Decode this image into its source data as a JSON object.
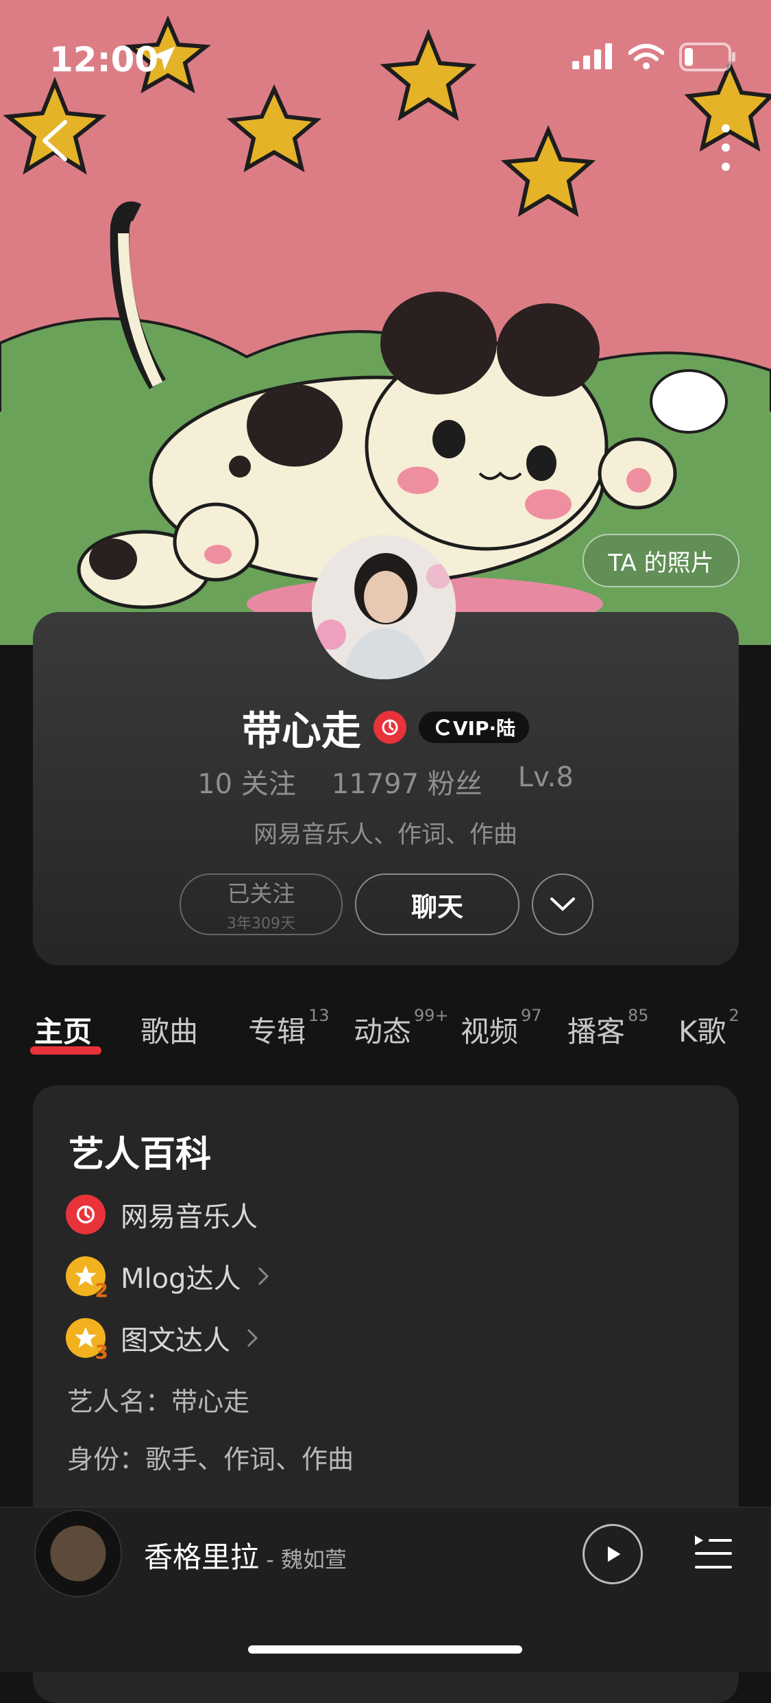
{
  "status": {
    "time": "12:00"
  },
  "photos_button": "TA 的照片",
  "profile": {
    "name": "带心走",
    "vip_label": "VIP·陆",
    "stats": [
      "10 关注",
      "11797 粉丝",
      "Lv.8"
    ],
    "bio": "网易音乐人、作词、作曲",
    "followed_label": "已关注",
    "followed_duration": "3年309天",
    "chat_label": "聊天"
  },
  "tabs": [
    {
      "label": "主页",
      "count": ""
    },
    {
      "label": "歌曲",
      "count": ""
    },
    {
      "label": "专辑",
      "count": "13"
    },
    {
      "label": "动态",
      "count": "99+"
    },
    {
      "label": "视频",
      "count": "97"
    },
    {
      "label": "播客",
      "count": "85"
    },
    {
      "label": "K歌",
      "count": "2"
    }
  ],
  "wiki": {
    "title": "艺人百科",
    "badges": [
      {
        "label": "网易音乐人",
        "icon": "netease-music-icon",
        "level": ""
      },
      {
        "label": "Mlog达人",
        "icon": "star-badge-icon",
        "level": "2"
      },
      {
        "label": "图文达人",
        "icon": "star-badge-icon",
        "level": "3"
      }
    ],
    "artist_name": "艺人名：带心走",
    "identity": "身份：歌手、作词、作曲"
  },
  "player": {
    "song": "香格里拉",
    "artist": " - 魏如萱"
  },
  "colors": {
    "accent": "#e8333a",
    "banner": "#dc7d86",
    "background": "#141414"
  }
}
